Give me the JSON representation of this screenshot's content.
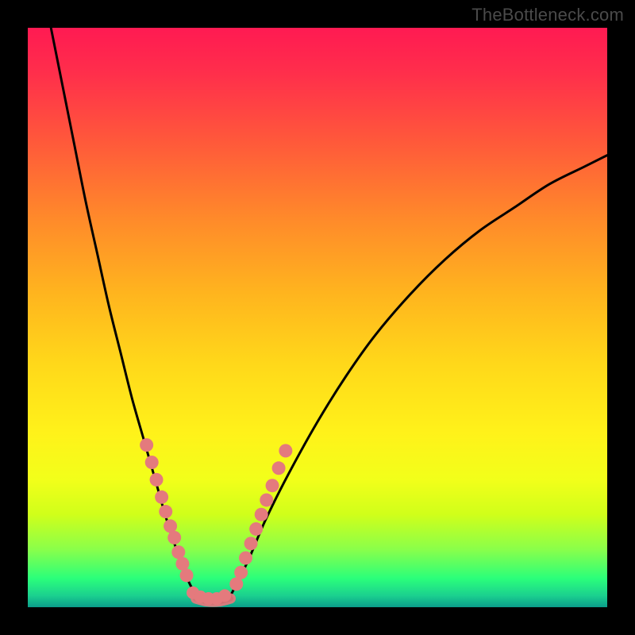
{
  "attribution": "TheBottleneck.com",
  "colors": {
    "gradient_top": "#ff1a52",
    "gradient_bottom": "#0b9d8a",
    "curve": "#000000",
    "dots": "#e47a7d",
    "frame": "#000000"
  },
  "chart_data": {
    "type": "line",
    "title": "",
    "xlabel": "",
    "ylabel": "",
    "xlim": [
      0,
      100
    ],
    "ylim": [
      0,
      100
    ],
    "grid": false,
    "legend": false,
    "series": [
      {
        "name": "left-branch",
        "x": [
          4,
          6,
          8,
          10,
          12,
          14,
          16,
          18,
          20,
          22,
          24,
          26,
          27.5,
          29
        ],
        "y": [
          100,
          90,
          80,
          70,
          61,
          52,
          44,
          36,
          29,
          22,
          15,
          9,
          5,
          2
        ]
      },
      {
        "name": "right-branch",
        "x": [
          35,
          38,
          41,
          45,
          50,
          55,
          60,
          66,
          72,
          78,
          84,
          90,
          96,
          100
        ],
        "y": [
          2,
          8,
          15,
          23,
          32,
          40,
          47,
          54,
          60,
          65,
          69,
          73,
          76,
          78
        ]
      },
      {
        "name": "floor",
        "x": [
          29,
          31,
          33,
          35
        ],
        "y": [
          1.5,
          1,
          1,
          1.5
        ]
      }
    ],
    "dots_left": [
      {
        "x": 20.5,
        "y": 28
      },
      {
        "x": 21.4,
        "y": 25
      },
      {
        "x": 22.2,
        "y": 22
      },
      {
        "x": 23.1,
        "y": 19
      },
      {
        "x": 23.8,
        "y": 16.5
      },
      {
        "x": 24.6,
        "y": 14
      },
      {
        "x": 25.3,
        "y": 12
      },
      {
        "x": 26.0,
        "y": 9.5
      },
      {
        "x": 26.7,
        "y": 7.5
      },
      {
        "x": 27.4,
        "y": 5.5
      }
    ],
    "dots_right": [
      {
        "x": 36.0,
        "y": 4
      },
      {
        "x": 36.8,
        "y": 6
      },
      {
        "x": 37.6,
        "y": 8.5
      },
      {
        "x": 38.5,
        "y": 11
      },
      {
        "x": 39.4,
        "y": 13.5
      },
      {
        "x": 40.3,
        "y": 16
      },
      {
        "x": 41.2,
        "y": 18.5
      },
      {
        "x": 42.2,
        "y": 21
      },
      {
        "x": 43.3,
        "y": 24
      },
      {
        "x": 44.5,
        "y": 27
      }
    ],
    "dots_floor": [
      {
        "x": 28.5,
        "y": 2.5
      },
      {
        "x": 29.8,
        "y": 1.8
      },
      {
        "x": 31.2,
        "y": 1.5
      },
      {
        "x": 32.6,
        "y": 1.5
      },
      {
        "x": 34.0,
        "y": 2.0
      }
    ]
  }
}
